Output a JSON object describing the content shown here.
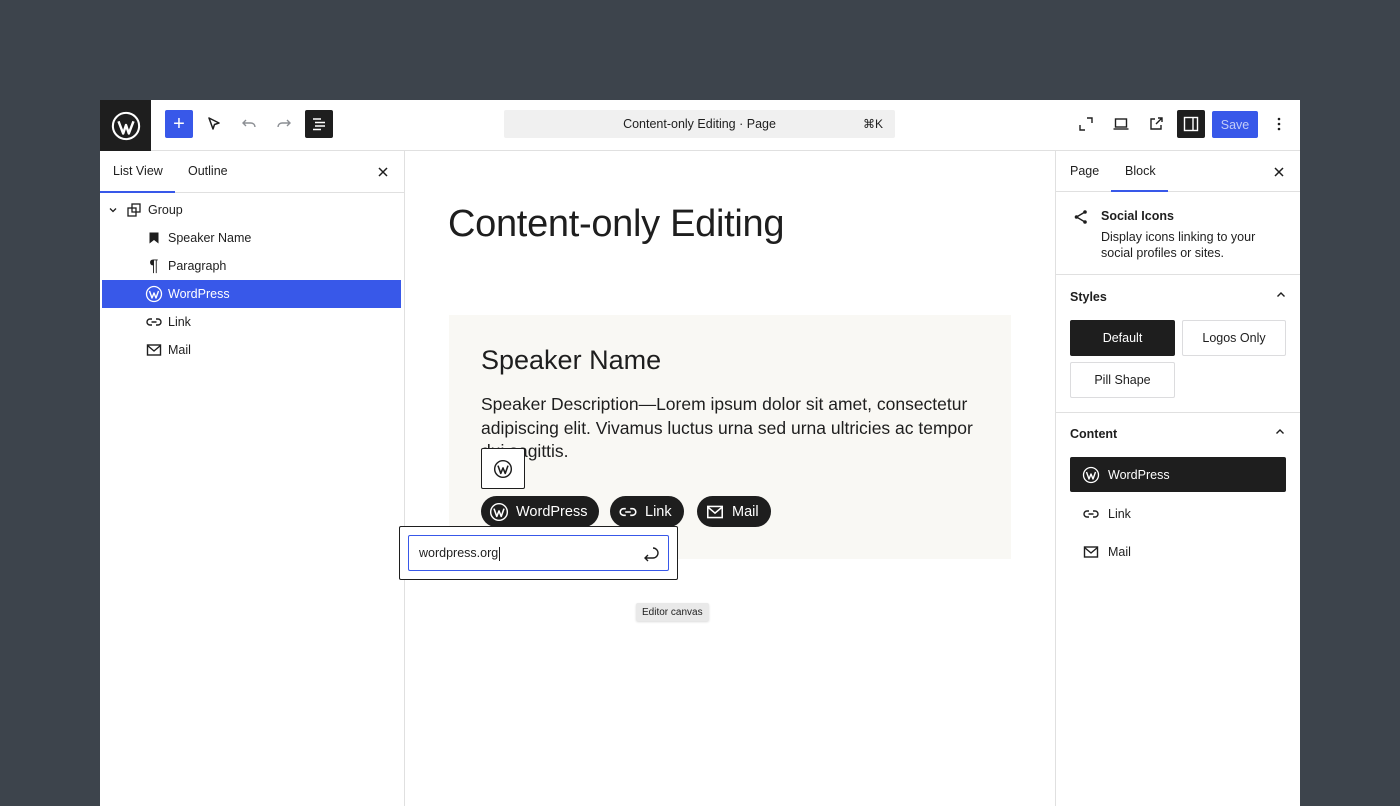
{
  "header": {
    "add_label": "+",
    "command_title": "Content-only Editing · Page",
    "command_shortcut": "⌘K",
    "save_label": "Save",
    "icons": [
      "wordpress-logo-icon",
      "add-icon",
      "select-tool-icon",
      "undo-icon",
      "redo-icon",
      "document-overview-icon",
      "fullscreen-icon",
      "device-preview-icon",
      "external-view-icon",
      "settings-sidebar-icon",
      "more-options-icon"
    ]
  },
  "left_panel": {
    "tabs": [
      "List View",
      "Outline"
    ],
    "active_tab": "List View",
    "tree": [
      {
        "label": "Group",
        "icon": "group-icon",
        "level": 0,
        "expanded": true
      },
      {
        "label": "Speaker Name",
        "icon": "bookmark-icon",
        "level": 1
      },
      {
        "label": "Paragraph",
        "icon": "paragraph-icon",
        "level": 1
      },
      {
        "label": "WordPress",
        "icon": "wordpress-icon",
        "level": 1,
        "selected": true
      },
      {
        "label": "Link",
        "icon": "link-icon",
        "level": 1
      },
      {
        "label": "Mail",
        "icon": "mail-icon",
        "level": 1
      }
    ]
  },
  "canvas": {
    "page_title": "Content-only Editing",
    "speaker_name": "Speaker Name",
    "speaker_description": "Speaker Description—Lorem ipsum dolor sit amet, consectetur adipiscing elit. Vivamus luctus urna sed urna ultricies ac tempor dui sagittis.",
    "social_links": [
      {
        "label": "WordPress",
        "icon": "wordpress-icon"
      },
      {
        "label": "Link",
        "icon": "link-icon"
      },
      {
        "label": "Mail",
        "icon": "mail-icon"
      }
    ],
    "link_input_value": "wordpress.org",
    "tooltip": "Editor canvas"
  },
  "right_panel": {
    "tabs": [
      "Page",
      "Block"
    ],
    "active_tab": "Block",
    "block_title": "Social Icons",
    "block_description": "Display icons linking to your social profiles or sites.",
    "styles_heading": "Styles",
    "styles": [
      "Default",
      "Logos Only",
      "Pill Shape"
    ],
    "active_style": "Default",
    "content_heading": "Content",
    "content_items": [
      {
        "label": "WordPress",
        "icon": "wordpress-icon",
        "selected": true
      },
      {
        "label": "Link",
        "icon": "link-icon"
      },
      {
        "label": "Mail",
        "icon": "mail-icon"
      }
    ]
  },
  "colors": {
    "background": "#3d444c",
    "accent": "#3858e9",
    "dark": "#1e1e1e",
    "group_background": "#f9f8f4"
  }
}
